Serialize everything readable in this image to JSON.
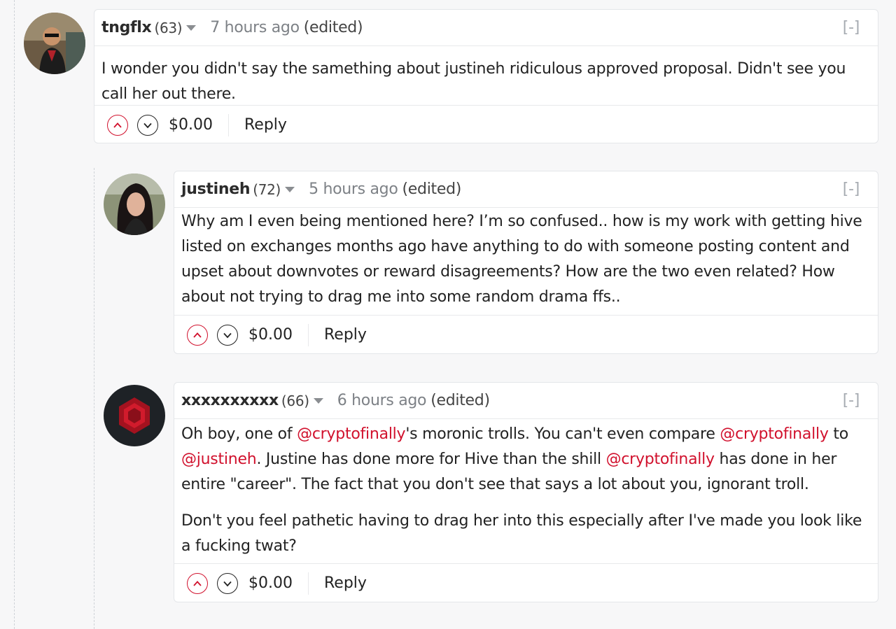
{
  "comments": [
    {
      "author": "tngflx",
      "reputation": "(63)",
      "time": "7 hours ago",
      "edited": "(edited)",
      "collapse": "[-]",
      "body": [
        "I wonder you didn't say the samething about justineh ridiculous approved proposal. Didn't see you call her out there."
      ],
      "payout": "$0.00",
      "reply": "Reply"
    },
    {
      "author": "justineh",
      "reputation": "(72)",
      "time": "5 hours ago",
      "edited": "(edited)",
      "collapse": "[-]",
      "body": [
        "Why am I even being mentioned here? I’m so confused.. how is my work with getting hive listed on exchanges months ago have anything to do with someone posting content and upset about downvotes or reward disagreements? How are the two even related? How about not trying to drag me into some random drama ffs.."
      ],
      "payout": "$0.00",
      "reply": "Reply"
    },
    {
      "author": "xxxxxxxxxx",
      "reputation": "(66)",
      "time": "6 hours ago",
      "edited": "(edited)",
      "collapse": "[-]",
      "body_p1": {
        "t1": "Oh boy, one of ",
        "m1": "@cryptofinally",
        "t2": "'s moronic trolls. You can't even compare ",
        "m2": "@cryptofinally",
        "t3": " to ",
        "m3": "@justineh",
        "t4": ". Justine has done more for Hive than the shill ",
        "m4": "@cryptofinally",
        "t5": " has done in her entire \"career\". The fact that you don't see that says a lot about you, ignorant troll."
      },
      "body_p2": "Don't you feel pathetic having to drag her into this especially after I've made you look like a fucking twat?",
      "payout": "$0.00",
      "reply": "Reply"
    }
  ],
  "colors": {
    "accent": "#d1112d",
    "muted": "#7d8186",
    "border": "#e4e6e9"
  },
  "icons": [
    "caret-down-icon",
    "upvote-icon",
    "downvote-icon"
  ]
}
